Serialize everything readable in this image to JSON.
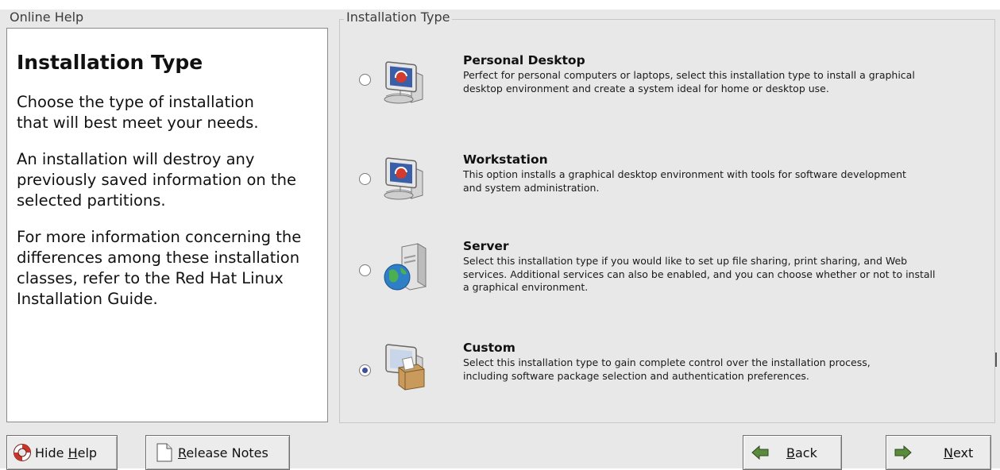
{
  "help": {
    "legend": "Online Help",
    "title": "Installation Type",
    "paragraphs": [
      "Choose the type of installation that will best meet your needs.",
      "An installation will destroy any previously saved information on the selected partitions.",
      "For more information concerning the differences among these installation classes, refer to the Red Hat Linux Installation Guide."
    ]
  },
  "install_type": {
    "legend": "Installation Type",
    "selected": "Custom",
    "options": [
      {
        "title": "Personal Desktop",
        "description": "Perfect for personal computers or laptops, select this installation type to install a graphical desktop environment and create a system ideal for home or desktop use.",
        "icon": "personal-desktop-icon",
        "checked": false
      },
      {
        "title": "Workstation",
        "description": "This option installs a graphical desktop environment with tools for software development and system administration.",
        "icon": "workstation-icon",
        "checked": false
      },
      {
        "title": "Server",
        "description": "Select this installation type if you would like to set up file sharing, print sharing, and Web services. Additional services can also be enabled, and you can choose whether or not to install a graphical environment.",
        "icon": "server-icon",
        "checked": false
      },
      {
        "title": "Custom",
        "description": "Select this installation type to gain complete control over the installation process, including software package selection and authentication preferences.",
        "icon": "custom-package-icon",
        "checked": true
      }
    ]
  },
  "buttons": {
    "hide_help": {
      "label_prefix": "Hide ",
      "mnemonic": "H",
      "label_rest": "elp",
      "icon": "lifebuoy-icon"
    },
    "release_notes": {
      "mnemonic": "R",
      "label_rest": "elease Notes",
      "icon": "document-icon"
    },
    "back": {
      "mnemonic": "B",
      "label_rest": "ack",
      "icon": "arrow-left-icon"
    },
    "next": {
      "mnemonic": "N",
      "label_rest": "ext",
      "icon": "arrow-right-icon"
    }
  },
  "colors": {
    "background": "#e8e8e8",
    "radio_selected": "#3e4f9e",
    "arrow_green": "#5a8a3c"
  }
}
